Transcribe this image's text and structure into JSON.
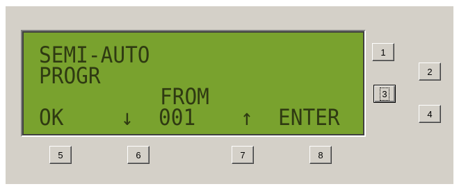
{
  "display": {
    "line1": "SEMI-AUTO",
    "line2": "PROGR",
    "line3": "FROM",
    "softkeys": {
      "ok": "OK",
      "down": "↓",
      "value": "001",
      "up": "↑",
      "enter": "ENTER"
    }
  },
  "side_buttons": [
    "1",
    "2",
    "3",
    "4"
  ],
  "bottom_buttons": [
    "5",
    "6",
    "7",
    "8"
  ],
  "focused_button": "3",
  "colors": {
    "panel": "#d4d0c8",
    "lcd_background": "#79a22e",
    "lcd_text": "#2f3a12"
  }
}
